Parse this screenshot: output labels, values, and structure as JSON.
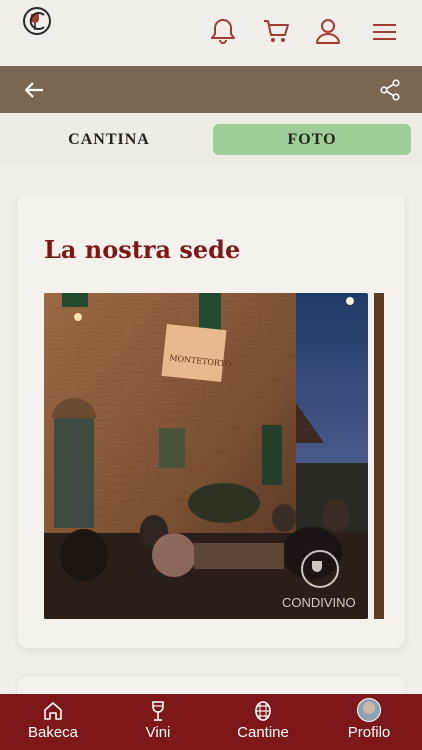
{
  "header": {
    "icons": [
      "logo-icon",
      "bell-icon",
      "cart-icon",
      "user-icon",
      "menu-icon"
    ],
    "accent_color": "#a33a34"
  },
  "subbar": {
    "color": "#7b6651",
    "icons": [
      "back-arrow-icon",
      "share-icon"
    ]
  },
  "tabs": [
    {
      "label": "CANTINA",
      "active": false
    },
    {
      "label": "FOTO",
      "active": true,
      "color": "#9fcf98"
    }
  ],
  "section": {
    "title": "La nostra sede",
    "photo_watermark": "CONDIVINO",
    "sign_text": "MONTETORTO"
  },
  "bottom_nav": {
    "color": "#7e1818",
    "items": [
      {
        "label": "Bakeca",
        "icon": "home-icon"
      },
      {
        "label": "Vini",
        "icon": "wine-glass-icon"
      },
      {
        "label": "Cantine",
        "icon": "barrel-icon"
      },
      {
        "label": "Profilo",
        "icon": "avatar"
      }
    ]
  }
}
